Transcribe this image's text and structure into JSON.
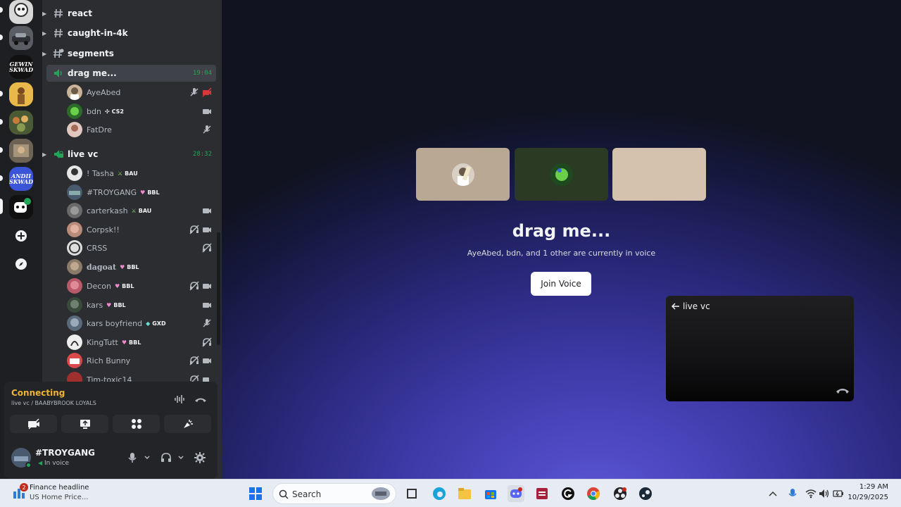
{
  "colors": {
    "voice_green": "#23a559",
    "connecting": "#f0b232",
    "muted_red": "#da373c",
    "sidebar_bg": "#2b2d31",
    "panel_bg": "#232428",
    "blurple": "#5865f2"
  },
  "rail": {
    "servers": [
      {
        "icon": "server-icon-avatar"
      },
      {
        "icon": "server-icon-car"
      },
      {
        "label": "GEWIN SKWAD"
      },
      {
        "icon": "server-icon-figure"
      },
      {
        "icon": "server-icon-crowd"
      },
      {
        "icon": "server-icon-photo"
      },
      {
        "label": "ANDII SKWAD"
      },
      {
        "icon": "server-icon-bot"
      }
    ],
    "add_icon": "plus-icon",
    "discover_icon": "compass-icon"
  },
  "channels": [
    {
      "name": "react",
      "type": "text"
    },
    {
      "name": "caught-in-4k",
      "type": "text"
    },
    {
      "name": "segments",
      "type": "text"
    },
    {
      "name": "drag me...",
      "type": "voice",
      "time": "19:04",
      "active": true
    },
    {
      "name": "live vc",
      "type": "voice-locked",
      "time": "28:32"
    }
  ],
  "drag_users": [
    {
      "name": "AyeAbed",
      "tag": "",
      "icons": [
        "mic-off-icon",
        "video-off-icon"
      ]
    },
    {
      "name": "bdn",
      "tag": "CS2",
      "tag_icon": "sparkle-icon",
      "icons": [
        "video-icon"
      ]
    },
    {
      "name": "FatDre",
      "tag": "",
      "icons": [
        "mic-off-icon"
      ]
    }
  ],
  "live_users": [
    {
      "name": "! Tasha",
      "tag": "BAU",
      "tag_icon": "sword-icon",
      "icons": []
    },
    {
      "name": "#TROYGANG",
      "tag": "BBL",
      "tag_icon": "heart-icon",
      "icons": []
    },
    {
      "name": "carterkash",
      "tag": "BAU",
      "tag_icon": "sword-icon",
      "icons": [
        "video-icon"
      ]
    },
    {
      "name": "Corpsk!!",
      "tag": "",
      "icons": [
        "deafen-icon",
        "video-icon"
      ]
    },
    {
      "name": "CRSS",
      "tag": "",
      "icons": [
        "deafen-icon"
      ]
    },
    {
      "name": "dagoat",
      "tag": "BBL",
      "tag_icon": "heart-icon",
      "bold": true,
      "icons": []
    },
    {
      "name": "Decon",
      "tag": "BBL",
      "tag_icon": "heart-icon",
      "icons": [
        "deafen-icon",
        "video-icon"
      ]
    },
    {
      "name": "kars",
      "tag": "BBL",
      "tag_icon": "heart-icon",
      "icons": [
        "video-icon"
      ]
    },
    {
      "name": "kars boyfriend",
      "tag": "GXD",
      "tag_icon": "gem-icon",
      "icons": [
        "mic-off-icon"
      ]
    },
    {
      "name": "KingTutt",
      "tag": "BBL",
      "tag_icon": "heart-icon",
      "icons": [
        "deafen-icon"
      ]
    },
    {
      "name": "Rich Bunny",
      "tag": "",
      "icons": [
        "deafen-icon",
        "video-icon"
      ]
    },
    {
      "name": "Tim-toxic14",
      "tag": "",
      "icons": [
        "deafen-icon",
        "video-icon"
      ]
    }
  ],
  "connection": {
    "status": "Connecting",
    "channel": "live vc / BAABYBROOK LOYALS"
  },
  "user_panel": {
    "name": "#TROYGANG",
    "status": "In voice"
  },
  "voice": {
    "title": "drag me...",
    "subtitle": "AyeAbed, bdn, and 1 other are currently in voice",
    "join_label": "Join Voice"
  },
  "popout": {
    "title": "live vc"
  },
  "taskbar": {
    "news_badge": "2",
    "news_title": "Finance headline",
    "news_sub": "US Home Price...",
    "search_label": "Search",
    "time": "1:29 AM",
    "date": "10/29/2025"
  }
}
